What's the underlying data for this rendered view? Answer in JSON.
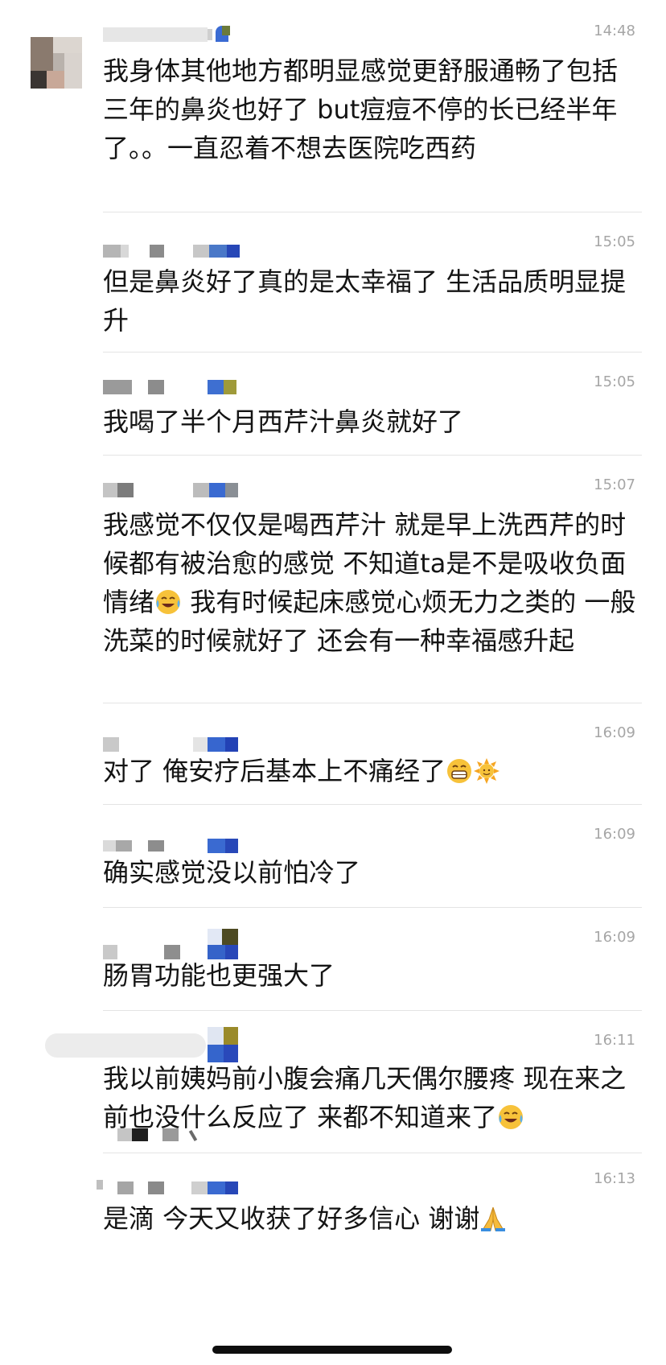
{
  "messages": [
    {
      "time": "14:48",
      "text": "我身体其他地方都明显感觉更舒服通畅了包括三年的鼻炎也好了 but痘痘不停的长已经半年了。。一直忍着不想去医院吃西药"
    },
    {
      "time": "15:05",
      "text": "但是鼻炎好了真的是太幸福了 生活品质明显提升"
    },
    {
      "time": "15:05",
      "text": "我喝了半个月西芹汁鼻炎就好了"
    },
    {
      "time": "15:07",
      "text_before": "我感觉不仅仅是喝西芹汁 就是早上洗西芹的时候都有被治愈的感觉 不知道ta是不是吸收负面情绪",
      "emoji": "tears-of-joy-emoji",
      "text_after": " 我有时候起床感觉心烦无力之类的 一般洗菜的时候就好了 还会有一种幸福感升起"
    },
    {
      "time": "16:09",
      "text": "对了 俺安疗后基本上不痛经了",
      "emojis": [
        "grinning-emoji",
        "sun-emoji"
      ]
    },
    {
      "time": "16:09",
      "text": "确实感觉没以前怕冷了"
    },
    {
      "time": "16:09",
      "text": "肠胃功能也更强大了"
    },
    {
      "time": "16:11",
      "text": "我以前姨妈前小腹会痛几天偶尔腰疼 现在来之前也没什么反应了 来都不知道来了",
      "emoji": "tears-of-joy-emoji"
    },
    {
      "time": "16:13",
      "text": "是滴 今天又收获了好多信心 谢谢",
      "emoji": "folded-hands-emoji"
    }
  ]
}
